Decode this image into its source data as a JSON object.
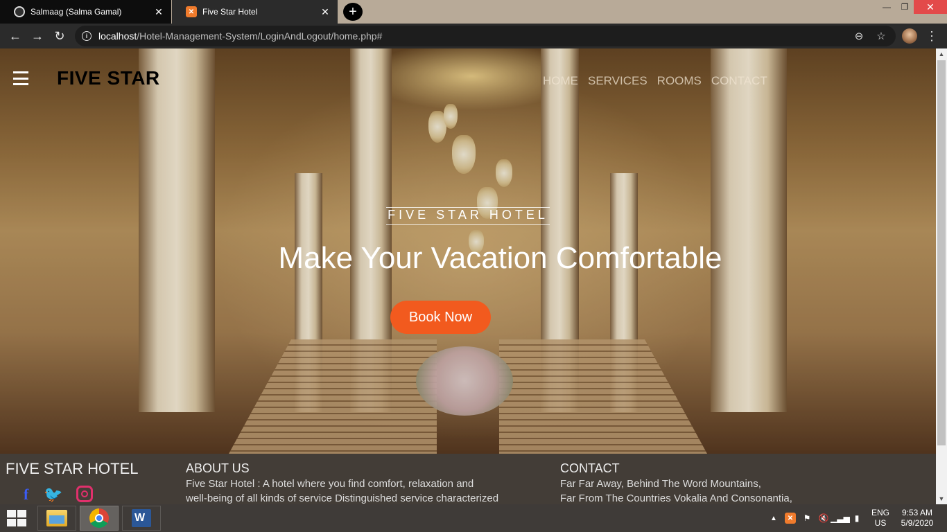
{
  "browser": {
    "tabs": [
      {
        "title": "Salmaag (Salma Gamal)",
        "active": false,
        "icon": "github-icon"
      },
      {
        "title": "Five Star Hotel",
        "active": true,
        "icon": "xampp-icon"
      }
    ],
    "url_host": "localhost",
    "url_path": "/Hotel-Management-System/LoginAndLogout/home.php#"
  },
  "page": {
    "brand": "FIVE STAR",
    "nav": [
      "HOME",
      "SERVICES",
      "ROOMS",
      "CONTACT"
    ],
    "hero": {
      "subtitle": "FIVE STAR HOTEL",
      "title": "Make Your Vacation Comfortable",
      "cta": "Book Now"
    },
    "footer": {
      "brand": "FIVE STAR HOTEL",
      "about_title": "ABOUT US",
      "about_lines": [
        "Five Star Hotel : A hotel where you find comfort, relaxation and",
        "well-being of all kinds of service Distinguished service characterized"
      ],
      "contact_title": "CONTACT",
      "contact_lines": [
        "Far Far Away, Behind The Word Mountains,",
        "Far From The Countries Vokalia And Consonantia,"
      ]
    }
  },
  "taskbar": {
    "lang_line1": "ENG",
    "lang_line2": "US",
    "time": "9:53 AM",
    "date": "5/9/2020"
  },
  "colors": {
    "accent_button": "#f25a1e",
    "footer_bg": "#46403a",
    "facebook": "#3b5cf5",
    "twitter": "#1da1f2",
    "instagram": "#e1306c"
  }
}
